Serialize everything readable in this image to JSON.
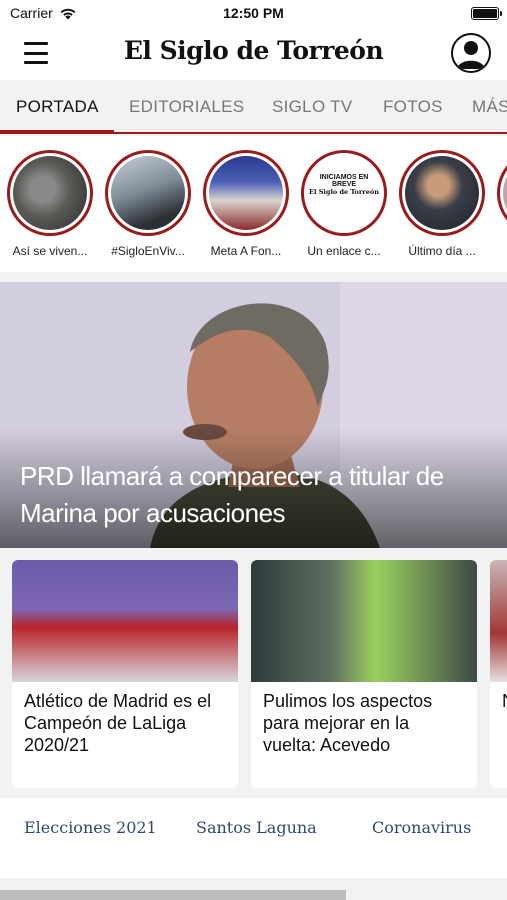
{
  "status_bar": {
    "carrier": "Carrier",
    "time": "12:50 PM"
  },
  "header": {
    "logo": "El Siglo de Torreón"
  },
  "tabs": [
    {
      "label": "PORTADA",
      "active": true
    },
    {
      "label": "EDITORIALES",
      "active": false
    },
    {
      "label": "SIGLO TV",
      "active": false
    },
    {
      "label": "FOTOS",
      "active": false
    },
    {
      "label": "MÁS",
      "active": false
    }
  ],
  "stories": [
    {
      "label": "Así se viven..."
    },
    {
      "label": "#SigloEnViv..."
    },
    {
      "label": "Meta A Fon..."
    },
    {
      "label": "Un enlace c..."
    },
    {
      "label": "Último día ..."
    }
  ],
  "story_overlays": {
    "brief_title": "INICIAMOS EN BREVE",
    "brief_logo": "El Siglo de Torreón"
  },
  "hero": {
    "headline": "PRD llamará a comparecer a titular de Marina por acusaciones"
  },
  "cards": [
    {
      "title": "Atlético de Madrid es el Campeón de LaLiga 2020/21"
    },
    {
      "title": "Pulimos los aspectos para mejorar en la vuelta: Acevedo"
    },
    {
      "title": "N e p"
    }
  ],
  "topics": [
    {
      "label": "Elecciones 2021"
    },
    {
      "label": "Santos Laguna"
    },
    {
      "label": "Coronavirus"
    }
  ],
  "colors": {
    "accent": "#9b1b1b",
    "topic": "#2f4a6e"
  }
}
